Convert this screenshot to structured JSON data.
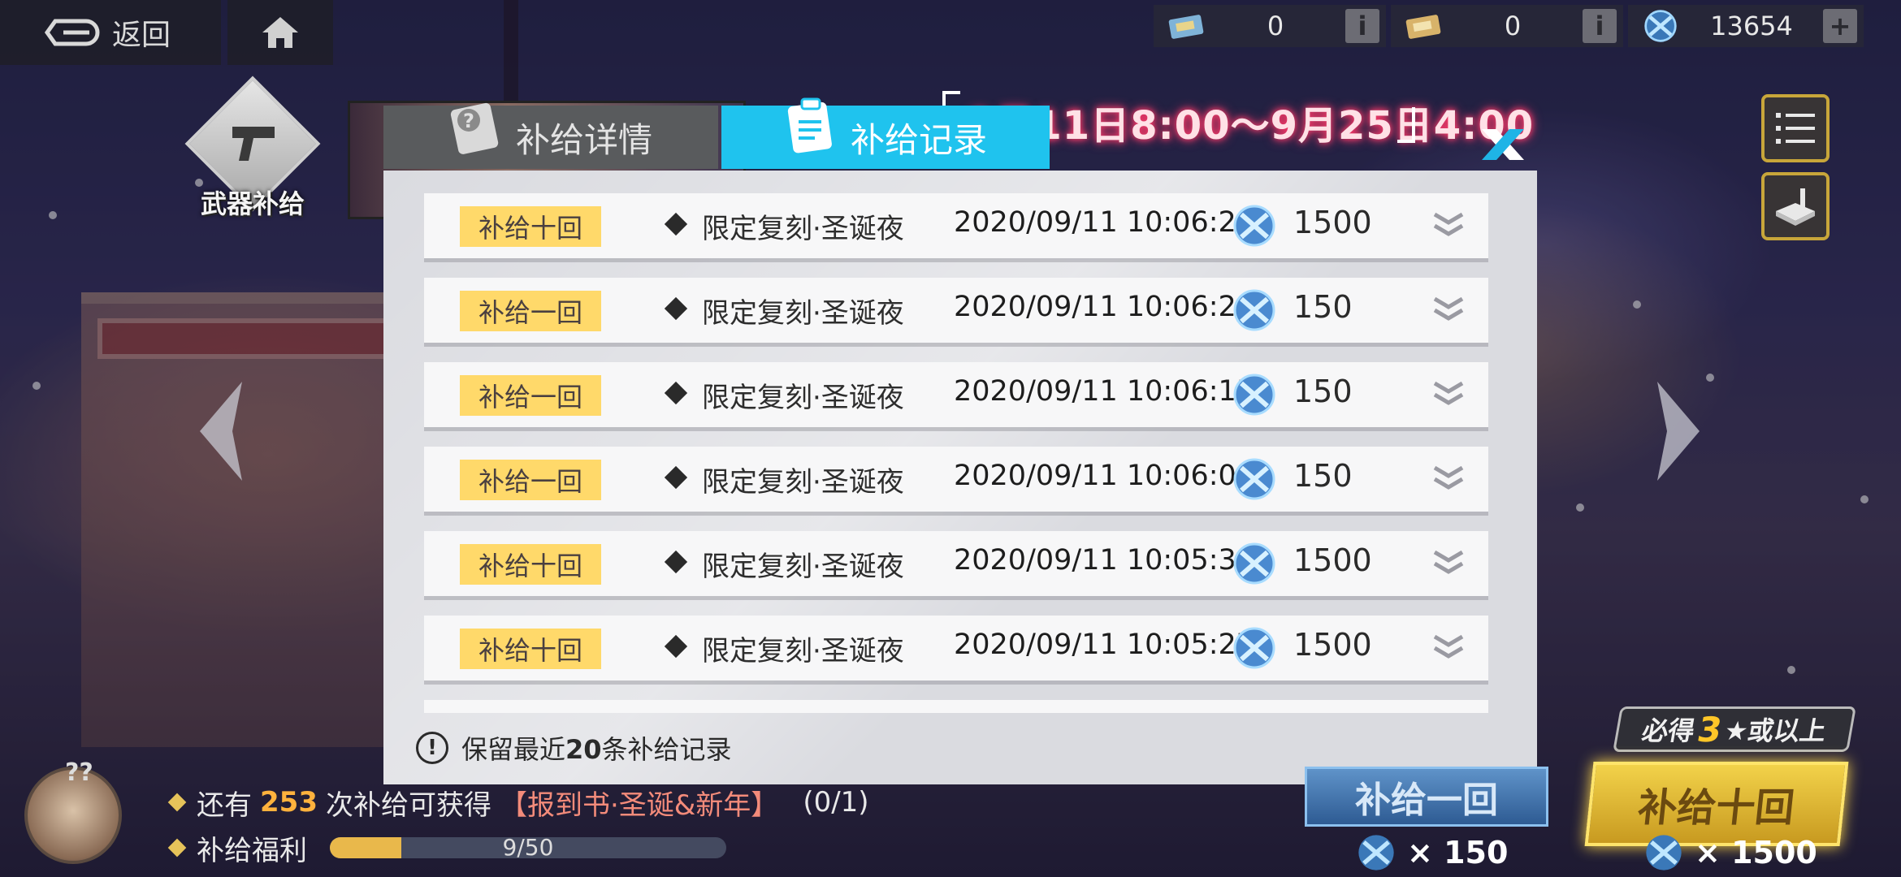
{
  "topbar": {
    "back_label": "返回",
    "currencies": [
      {
        "icon": "ticket-blue-icon",
        "value": "0"
      },
      {
        "icon": "ticket-gold-icon",
        "value": "0"
      },
      {
        "icon": "crystal-icon",
        "value": "13654"
      }
    ]
  },
  "sidebar": {
    "weapon_tab_label": "武器补给"
  },
  "event": {
    "date_range": "9月11日8:00～9月25日4:00"
  },
  "modal": {
    "tabs": [
      {
        "label": "补给详情",
        "icon": "question-clipboard-icon",
        "active": false
      },
      {
        "label": "补给记录",
        "icon": "clipboard-icon",
        "active": true
      }
    ],
    "records": [
      {
        "type": "补给十回",
        "pool": "限定复刻·圣诞夜",
        "time": "2020/09/11 10:06:29",
        "cost": "1500"
      },
      {
        "type": "补给一回",
        "pool": "限定复刻·圣诞夜",
        "time": "2020/09/11 10:06:20",
        "cost": "150"
      },
      {
        "type": "补给一回",
        "pool": "限定复刻·圣诞夜",
        "time": "2020/09/11 10:06:15",
        "cost": "150"
      },
      {
        "type": "补给一回",
        "pool": "限定复刻·圣诞夜",
        "time": "2020/09/11 10:06:09",
        "cost": "150"
      },
      {
        "type": "补给十回",
        "pool": "限定复刻·圣诞夜",
        "time": "2020/09/11 10:05:36",
        "cost": "1500"
      },
      {
        "type": "补给十回",
        "pool": "限定复刻·圣诞夜",
        "time": "2020/09/11 10:05:27",
        "cost": "1500"
      }
    ],
    "footer_note_pre": "保留最近",
    "footer_note_num": "20",
    "footer_note_post": "条补给记录"
  },
  "bottom": {
    "remaining_pre": "还有",
    "remaining_count": "253",
    "remaining_mid": "次补给可获得",
    "reward_name": "【报到书·圣诞&新年】",
    "reward_progress": "(0/1)",
    "welfare_label": "补给福利",
    "welfare_progress_text": "9/50",
    "welfare_progress": 0.18,
    "must_get_pre": "必得",
    "must_get_num": "3",
    "must_get_post": "★或以上",
    "single_btn": "补给一回",
    "ten_btn": "补给十回",
    "single_price": "× 150",
    "ten_price": "× 1500"
  },
  "colors": {
    "active_tab": "#1fc3ee",
    "badge": "#ffd96a",
    "gold": "#ffc628"
  }
}
